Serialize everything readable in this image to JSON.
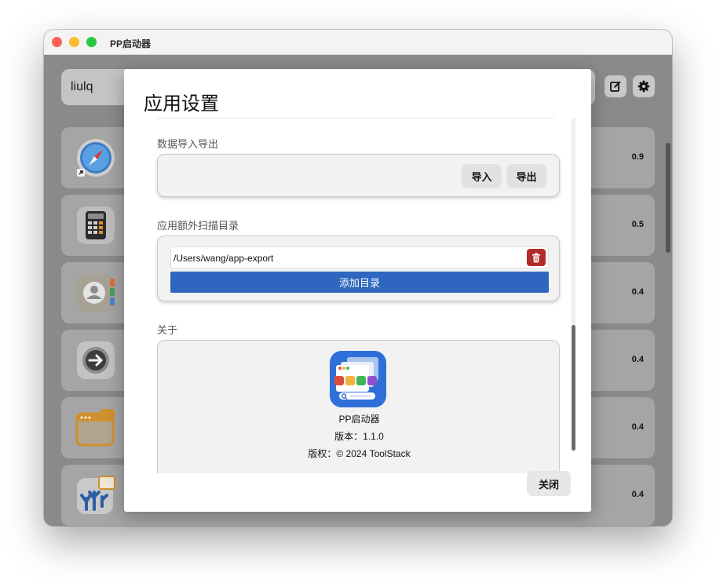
{
  "window": {
    "title": "PP启动器"
  },
  "search": {
    "value": "liulq"
  },
  "toolbar": {
    "edit_icon": "edit-icon",
    "settings_icon": "gear-icon"
  },
  "apps": [
    {
      "icon": "safari-icon",
      "value": "0.9"
    },
    {
      "icon": "calculator-icon",
      "value": "0.5"
    },
    {
      "icon": "contacts-icon",
      "value": "0.4"
    },
    {
      "icon": "migration-arrow-icon",
      "value": "0.4"
    },
    {
      "icon": "window-app-icon",
      "value": "0.4"
    },
    {
      "icon": "coral-app-icon",
      "value": "0.4"
    }
  ],
  "settings": {
    "title": "应用设置",
    "data_section": {
      "label": "数据导入导出",
      "import_label": "导入",
      "export_label": "导出"
    },
    "scan_section": {
      "label": "应用额外扫描目录",
      "directories": [
        "/Users/wang/app-export"
      ],
      "add_label": "添加目录"
    },
    "about_section": {
      "label": "关于",
      "app_name": "PP启动器",
      "version": "版本：1.1.0",
      "copyright": "版权：© 2024 ToolStack"
    },
    "close_label": "关闭"
  },
  "colors": {
    "primary_button": "#2f67c0",
    "danger_button": "#b22a2a",
    "traffic_red": "#ff5f57",
    "traffic_yellow": "#febc2e",
    "traffic_green": "#28c840"
  }
}
